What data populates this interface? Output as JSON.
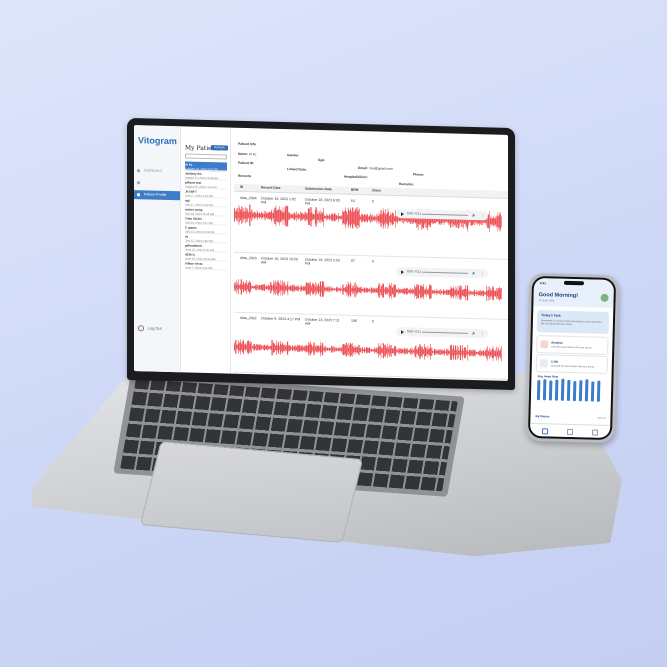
{
  "app": {
    "logo": "Vitogram",
    "nav": [
      "Dashboard",
      "",
      "Patient Profile"
    ],
    "logout_label": "Log Out"
  },
  "patients": {
    "title": "My Patients",
    "refresh_label": "Refresh",
    "search_placeholder": "",
    "items": [
      {
        "name": "dr ko",
        "date": "October 18, 2023 3:53 PM"
      },
      {
        "name": "Jordany Ike",
        "date": "August 16, 2023 10:48 AM"
      },
      {
        "name": "pillows test",
        "date": "August 15, 2023 7:06 PM"
      },
      {
        "name": "Jit DM-T",
        "date": "July 27, 2023 1:13 PM"
      },
      {
        "name": "rgji",
        "date": "July 27, 2023 1:10 PM"
      },
      {
        "name": "mister wang",
        "date": "July 24, 2023 11:18 AM"
      },
      {
        "name": "Trian SGAN",
        "date": "July 14, 2023 3:57 PM"
      },
      {
        "name": "C ganax",
        "date": "July 13, 2023 12:08 PM"
      },
      {
        "name": "es",
        "date": "July 12, 2023 2:45 PM"
      },
      {
        "name": "gilhsaldozlz",
        "date": "June 23, 2023 5:25 PM"
      },
      {
        "name": "4336 G",
        "date": "June 15, 2023 10:36 AM"
      },
      {
        "name": "Villion Yevts",
        "date": "June 7, 2023 2:32 PM"
      }
    ]
  },
  "profile": {
    "header": "Patient Info",
    "name_label": "Name:",
    "name_value": "dr ko",
    "gender_label": "Gender:",
    "age_label": "Age:",
    "email_label": "Email:",
    "email_value": "rmo@gmail.com",
    "phone_label": "Phone:",
    "patient_id_label": "Patient ID:",
    "linked_date_label": "Linked Date:",
    "hospital_label": "Hospital/Clinic:",
    "remarks_label": "Remarks:",
    "records_label": "Records"
  },
  "table": {
    "headers": [
      "ID",
      "Record Date",
      "Submission Date",
      "BPM",
      "Class"
    ],
    "rows": [
      {
        "id": "data_2004",
        "record_date": "October 18, 2023 1:02 PM",
        "submission_date": "October 18, 2023 6:03 PM",
        "bpm": "64",
        "class": "0",
        "time": "0:00 / 0:11"
      },
      {
        "id": "data_2003",
        "record_date": "October 16, 2023 10:50 AM",
        "submission_date": "October 18, 2023 5:53 PM",
        "bpm": "87",
        "class": "0",
        "time": "0:00 / 0:11"
      },
      {
        "id": "data_2002",
        "record_date": "October 8, 2023 4:17 PM",
        "submission_date": "October 13, 2023 7:11 AM",
        "bpm": "106",
        "class": "0",
        "time": "0:00 / 0:11"
      }
    ]
  },
  "phone": {
    "status_time": "9:41",
    "greeting": "Good Morning!",
    "date": "10 June 2024",
    "task_title": "Today's Task",
    "task_text": "Remember to conduct heart auscultation today and share the recording with your doctor.",
    "card1_title": "Bianjitzo",
    "card1_text": "Checked auscultation with your doctor",
    "card2_title": "3.3bb",
    "card2_text": "Checked 30 auscultation with your doctor",
    "hr_label": "Avg. Heart Rate",
    "hr_values": [
      78,
      82,
      75,
      80,
      84,
      79,
      77,
      81,
      83,
      76,
      80
    ],
    "diaries_label": "My Diaries",
    "diaries_link": "View all",
    "colors": {
      "accent": "#3d7cc9",
      "wave": "#e8242b"
    }
  }
}
